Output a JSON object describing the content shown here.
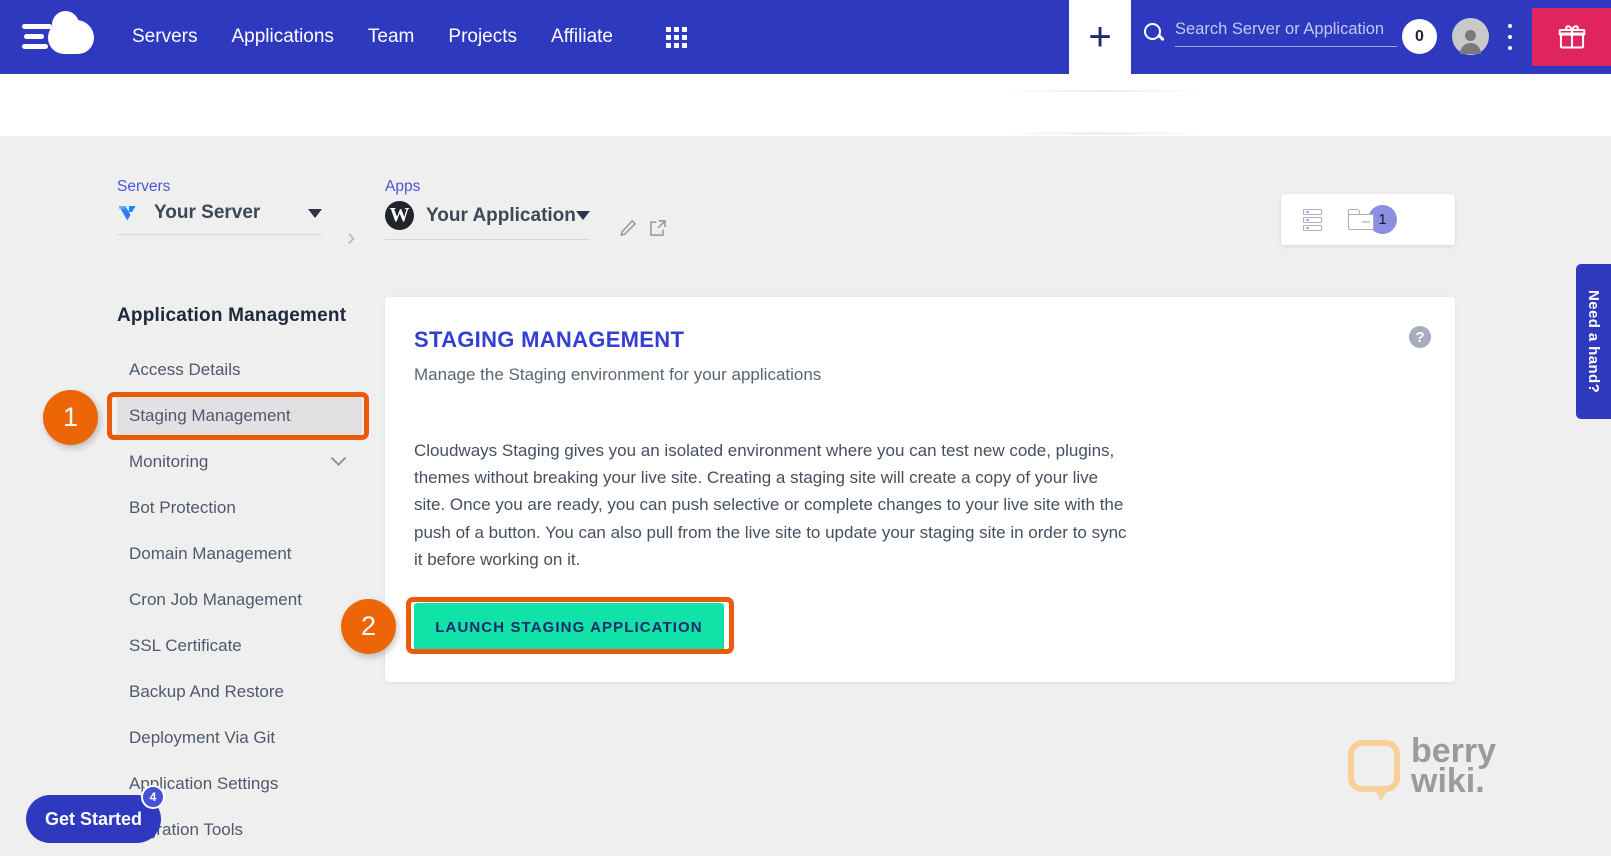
{
  "topnav": {
    "logo_name": "cloudways-logo",
    "links": [
      "Servers",
      "Applications",
      "Team",
      "Projects",
      "Affiliate"
    ],
    "grid_icon": "apps-grid-icon",
    "plus_label": "+",
    "search": {
      "placeholder": "Search Server or Application",
      "value": ""
    },
    "notification_count": "0",
    "kebab_icon": "more-vertical-icon",
    "gift_icon": "gift-icon",
    "colors": {
      "bar": "#2e39bf",
      "gift_bg": "#e0245e"
    }
  },
  "selectors": {
    "server": {
      "label": "Servers",
      "name": "Your Server",
      "icon": "vultr-icon"
    },
    "app": {
      "label": "Apps",
      "name": "Your Application",
      "icon": "wordpress-icon",
      "letter": "W"
    },
    "separator": "›",
    "edit_icon": "pencil-icon",
    "open_icon": "external-link-icon"
  },
  "env_card": {
    "server_icon": "server-stack-icon",
    "folder_icon": "folder-icon",
    "folder_count": "1"
  },
  "sidebar": {
    "title": "Application Management",
    "items": [
      {
        "label": "Access Details",
        "active": false,
        "expandable": false
      },
      {
        "label": "Staging Management",
        "active": true,
        "expandable": false
      },
      {
        "label": "Monitoring",
        "active": false,
        "expandable": true
      },
      {
        "label": "Bot Protection",
        "active": false,
        "expandable": false
      },
      {
        "label": "Domain Management",
        "active": false,
        "expandable": false
      },
      {
        "label": "Cron Job Management",
        "active": false,
        "expandable": false
      },
      {
        "label": "SSL Certificate",
        "active": false,
        "expandable": false
      },
      {
        "label": "Backup And Restore",
        "active": false,
        "expandable": false
      },
      {
        "label": "Deployment Via Git",
        "active": false,
        "expandable": false
      },
      {
        "label": "Application Settings",
        "active": false,
        "expandable": false
      },
      {
        "label": "Migration Tools",
        "active": false,
        "expandable": false
      }
    ]
  },
  "card": {
    "title": "STAGING MANAGEMENT",
    "subtitle": "Manage the Staging environment for your applications",
    "body": "Cloudways Staging gives you an isolated environment where you can test new code, plugins, themes without breaking your live site. Creating a staging site will create a copy of your live site. Once you are ready, you can push selective or complete changes to your live site with the push of a button. You can also pull from the live site to update your staging site in order to sync it before working on it.",
    "button_label": "LAUNCH STAGING APPLICATION",
    "help_icon": "question-mark-icon",
    "button_color": "#10e2a8"
  },
  "annotations": {
    "step_1": "1",
    "step_2": "2",
    "highlight_color": "#eb5b0b"
  },
  "need_hand": {
    "label": "Need a hand?"
  },
  "get_started": {
    "label": "Get Started",
    "badge": "4"
  },
  "watermark": {
    "line1": "berry",
    "line2": "wiki."
  }
}
